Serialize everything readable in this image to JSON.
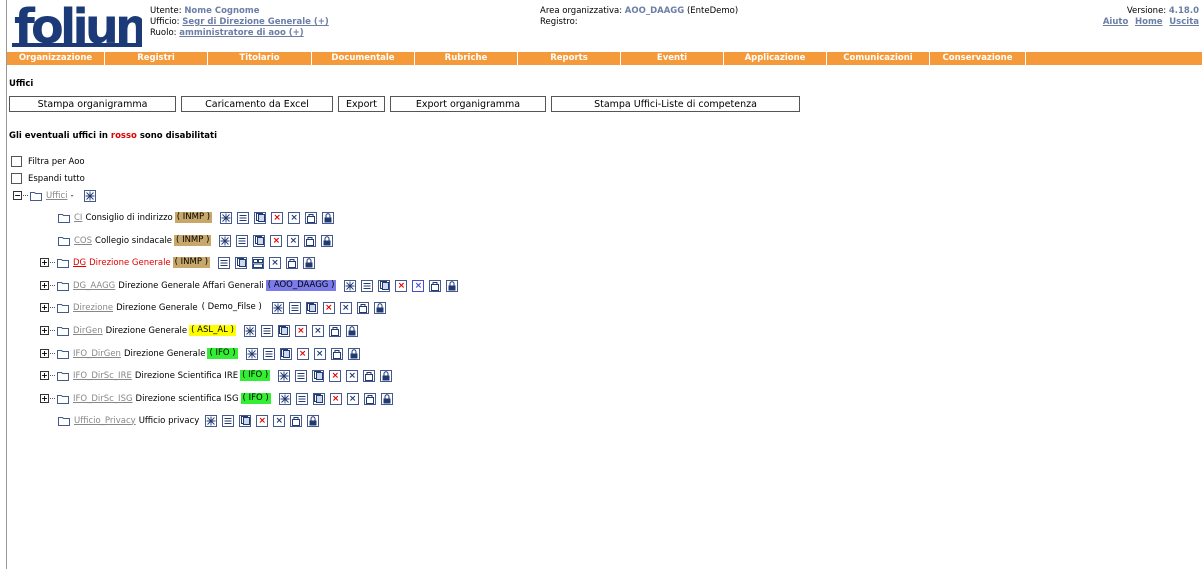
{
  "header": {
    "logo_text": "folium",
    "utente_label": "Utente:",
    "utente_value": "Nome Cognome",
    "ufficio_label": "Ufficio:",
    "ufficio_value": "Segr di Direzione Generale (+)",
    "ruolo_label": "Ruolo:",
    "ruolo_value": "amministratore di aoo (+)",
    "area_label": "Area organizzativa:",
    "area_value": "AOO_DAAGG",
    "area_ente": "(EnteDemo)",
    "registro_label": "Registro:",
    "versione_label": "Versione:",
    "versione_value": "4.18.0",
    "links": [
      "Aiuto",
      "Home",
      "Uscita"
    ]
  },
  "menu": [
    "Organizzazione",
    "Registri",
    "Titolario",
    "Documentale",
    "Rubriche",
    "Reports",
    "Eventi",
    "Applicazione",
    "Comunicazioni",
    "Conservazione"
  ],
  "page": {
    "title": "Uffici",
    "buttons": [
      "Stampa organigramma",
      "Caricamento da Excel",
      "Export",
      "Export organigramma",
      "Stampa Uffici-Liste di competenza"
    ],
    "notice_prefix": "Gli eventuali uffici in ",
    "notice_red": "rosso",
    "notice_suffix": " sono disabilitati",
    "filtra_label": "Filtra per Aoo",
    "espandi_label": "Espandi tutto",
    "root_label": "Uffici",
    "root_dash": "-"
  },
  "colors": {
    "menu_bg": "#f49a3a",
    "badge_inmp": "#c8a86a",
    "badge_aoo": "#7b7bea",
    "badge_asl": "#ffff00",
    "badge_ifo": "#33ee33",
    "disabled_text": "#e00000"
  },
  "tree": [
    {
      "code": "CI",
      "name": "Consiglio di indirizzo",
      "badge": "( INMP )",
      "badge_color": "#c8a86a",
      "expandable": false,
      "disabled": false,
      "icons": [
        "move-icon",
        "list-icon",
        "copy-icon",
        "delete-red-icon",
        "remove-icon",
        "role-icon",
        "lock-icon"
      ]
    },
    {
      "code": "COS",
      "name": "Collegio sindacale",
      "badge": "( INMP )",
      "badge_color": "#c8a86a",
      "expandable": false,
      "disabled": false,
      "icons": [
        "move-icon",
        "list-icon",
        "copy-icon",
        "delete-red-icon",
        "remove-icon",
        "role-icon",
        "lock-icon"
      ]
    },
    {
      "code": "DG",
      "name": "Direzione Generale",
      "badge": "( INMP )",
      "badge_color": "#c8a86a",
      "expandable": true,
      "disabled": true,
      "icons": [
        "list-icon",
        "copy-icon",
        "restore-icon",
        "remove-icon",
        "role-icon",
        "lock-icon"
      ]
    },
    {
      "code": "DG_AAGG",
      "name": "Direzione Generale Affari Generali",
      "badge": "( AOO_DAAGG )",
      "badge_color": "#7b7bea",
      "expandable": true,
      "disabled": false,
      "icons": [
        "move-icon",
        "list-icon",
        "copy-icon",
        "delete-red-icon",
        "remove-blue-icon",
        "role-icon",
        "lock-icon"
      ]
    },
    {
      "code": "Direzione",
      "name": "Direzione Generale",
      "badge": "( Demo_Filse )",
      "badge_color": "",
      "expandable": true,
      "disabled": false,
      "icons": [
        "move-icon",
        "list-icon",
        "copy-icon",
        "delete-red-icon",
        "remove-icon",
        "role-icon",
        "lock-icon"
      ]
    },
    {
      "code": "DirGen",
      "name": "Direzione Generale",
      "badge": "( ASL_AL )",
      "badge_color": "#ffff00",
      "expandable": true,
      "disabled": false,
      "icons": [
        "move-icon",
        "list-icon",
        "copy-icon",
        "delete-red-icon",
        "remove-icon",
        "role-icon",
        "lock-icon"
      ]
    },
    {
      "code": "IFO_DirGen",
      "name": "Direzione Generale",
      "badge": "( IFO )",
      "badge_color": "#33ee33",
      "expandable": true,
      "disabled": false,
      "icons": [
        "move-icon",
        "list-icon",
        "copy-icon",
        "delete-red-icon",
        "remove-icon",
        "role-icon",
        "lock-icon"
      ]
    },
    {
      "code": "IFO_DirSc_IRE",
      "name": "Direzione Scientifica IRE",
      "badge": "( IFO )",
      "badge_color": "#33ee33",
      "expandable": true,
      "disabled": false,
      "icons": [
        "move-icon",
        "list-icon",
        "copy-icon",
        "delete-red-icon",
        "remove-icon",
        "role-icon",
        "lock-icon"
      ]
    },
    {
      "code": "IFO_DirSc_ISG",
      "name": "Direzione scientifica ISG",
      "badge": "( IFO )",
      "badge_color": "#33ee33",
      "expandable": true,
      "disabled": false,
      "icons": [
        "move-icon",
        "list-icon",
        "copy-icon",
        "delete-red-icon",
        "remove-icon",
        "role-icon",
        "lock-icon"
      ]
    },
    {
      "code": "Ufficio_Privacy",
      "name": "Ufficio privacy",
      "badge": "",
      "badge_color": "",
      "expandable": false,
      "disabled": false,
      "icons": [
        "move-icon",
        "list-icon",
        "copy-icon",
        "delete-red-icon",
        "remove-icon",
        "role-icon",
        "lock-icon"
      ]
    }
  ]
}
